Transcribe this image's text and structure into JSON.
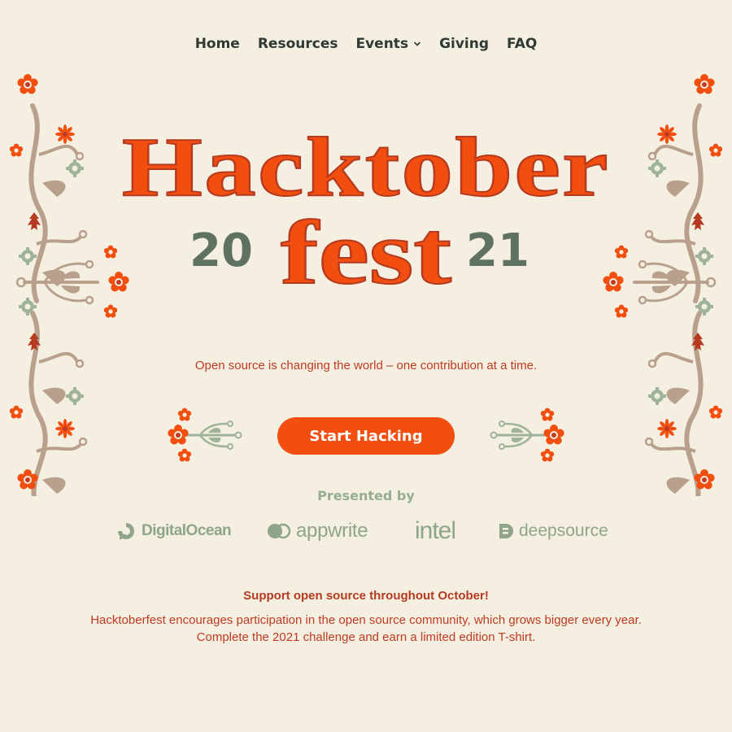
{
  "nav": {
    "items": [
      {
        "label": "Home"
      },
      {
        "label": "Resources"
      },
      {
        "label": "Events",
        "has_dropdown": true
      },
      {
        "label": "Giving"
      },
      {
        "label": "FAQ"
      }
    ]
  },
  "hero": {
    "title_word1": "Hacktober",
    "title_word2": "fest",
    "year_left": "20",
    "year_right": "21",
    "tagline": "Open source is changing the world – one contribution at a time.",
    "cta_label": "Start Hacking"
  },
  "sponsors": {
    "heading": "Presented by",
    "items": [
      {
        "name": "DigitalOcean",
        "icon": "digitalocean-logo-icon"
      },
      {
        "name": "appwrite",
        "icon": "appwrite-logo-icon"
      },
      {
        "name": "intel",
        "icon": "intel-logo-icon"
      },
      {
        "name": "deepsource",
        "icon": "deepsource-logo-icon"
      }
    ]
  },
  "support": {
    "heading": "Support open source throughout October!",
    "body": "Hacktoberfest encourages participation in the open source community, which grows bigger every year. Complete the 2021 challenge and earn a limited edition T-shirt."
  },
  "colors": {
    "background": "#f4efe1",
    "primary_orange": "#f24e0f",
    "dark_red": "#b53a20",
    "sage_green": "#8fa58a",
    "dark_green": "#5f7261",
    "nav_text": "#2e3a33"
  }
}
